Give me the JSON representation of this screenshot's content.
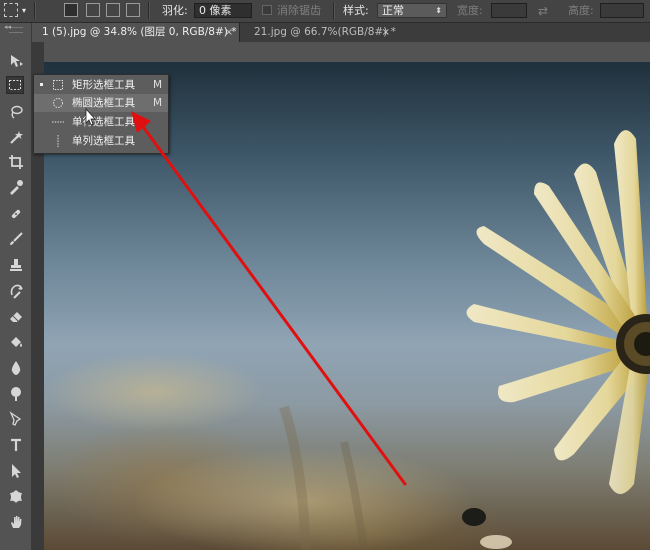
{
  "options_bar": {
    "feather_label": "羽化:",
    "feather_value": "0 像素",
    "antialias_label": "消除锯齿",
    "style_label": "样式:",
    "style_value": "正常",
    "width_label": "宽度:",
    "height_label": "高度:"
  },
  "tabs": [
    {
      "label": "1 (5).jpg @ 34.8% (图层 0, RGB/8#) *",
      "close": "×",
      "active": true
    },
    {
      "label": "21.jpg @ 66.7%(RGB/8#) *",
      "close": "×",
      "active": false
    }
  ],
  "flyout": {
    "items": [
      {
        "label": "矩形选框工具",
        "shortcut": "M",
        "icon": "rect-marquee-icon",
        "current": true
      },
      {
        "label": "椭圆选框工具",
        "shortcut": "M",
        "icon": "ellipse-marquee-icon",
        "current": false
      },
      {
        "label": "单行选框工具",
        "shortcut": "",
        "icon": "single-row-marquee-icon",
        "current": false
      },
      {
        "label": "单列选框工具",
        "shortcut": "",
        "icon": "single-column-marquee-icon",
        "current": false
      }
    ]
  },
  "toolbar": {
    "tools": [
      "move-tool-icon",
      "marquee-tool-icon",
      "lasso-tool-icon",
      "magic-wand-icon",
      "crop-tool-icon",
      "eyedropper-icon",
      "healing-brush-icon",
      "brush-tool-icon",
      "clone-stamp-icon",
      "history-brush-icon",
      "eraser-icon",
      "paint-bucket-icon",
      "blur-tool-icon",
      "dodge-tool-icon",
      "pen-tool-icon",
      "type-tool-icon",
      "path-selection-icon",
      "custom-shape-icon",
      "hand-tool-icon"
    ]
  },
  "annotation": {
    "arrow_color": "#e01010"
  }
}
